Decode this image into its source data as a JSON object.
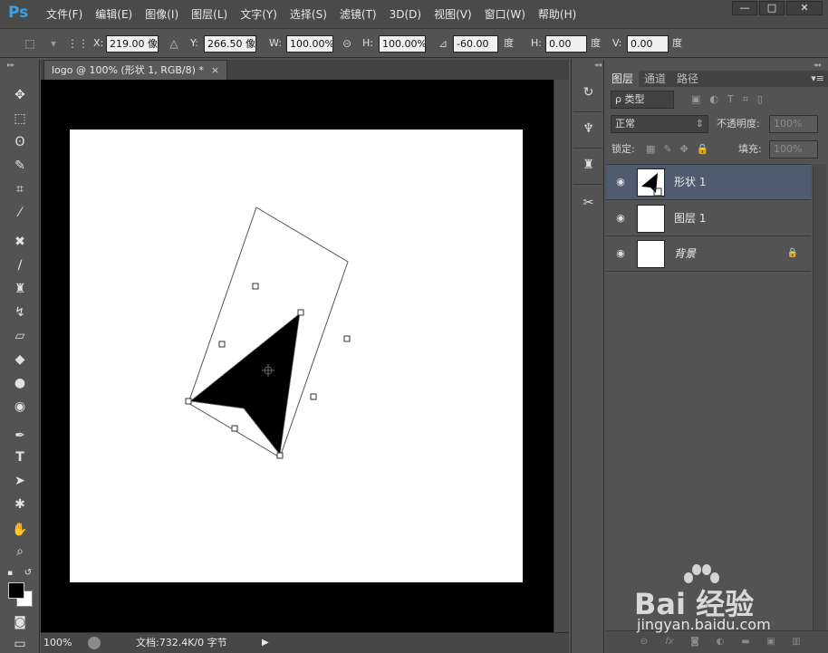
{
  "app": {
    "logo": "Ps"
  },
  "menu": [
    "文件(F)",
    "编辑(E)",
    "图像(I)",
    "图层(L)",
    "文字(Y)",
    "选择(S)",
    "滤镜(T)",
    "3D(D)",
    "视图(V)",
    "窗口(W)",
    "帮助(H)"
  ],
  "window_controls": {
    "minimize": "—",
    "maximize": "□",
    "close": "✕"
  },
  "options": {
    "x_label": "X:",
    "x_value": "219.00 像",
    "delta_icon": "△",
    "y_label": "Y:",
    "y_value": "266.50 像",
    "w_label": "W:",
    "w_value": "100.00%",
    "link_icon": "⊝",
    "h_label": "H:",
    "h_value": "100.00%",
    "angle_icon": "⊿",
    "angle_value": "-60.00",
    "angle_unit": "度",
    "hskew_label": "H:",
    "hskew_value": "0.00",
    "hskew_unit": "度",
    "vskew_label": "V:",
    "vskew_value": "0.00",
    "vskew_unit": "度"
  },
  "document": {
    "tab_title": "logo @ 100% (形状 1, RGB/8) *",
    "tab_close": "×"
  },
  "status": {
    "zoom": "100%",
    "doc_info": "文档:732.4K/0 字节",
    "arrow": "▶"
  },
  "layers_panel": {
    "collapse": "◂◂",
    "tabs": [
      "图层",
      "通道",
      "路径"
    ],
    "menu_icon": "▾≡",
    "filter_kind": "ρ 类型",
    "blend_mode": "正常",
    "opacity_label": "不透明度:",
    "opacity_value": "100%",
    "lock_label": "锁定:",
    "fill_label": "填充:",
    "fill_value": "100%",
    "layers": [
      {
        "name": "形状 1",
        "selected": true,
        "italic": false,
        "locked": false
      },
      {
        "name": "图层 1",
        "selected": false,
        "italic": false,
        "locked": false
      },
      {
        "name": "背景",
        "selected": false,
        "italic": true,
        "locked": true
      }
    ]
  },
  "watermark": {
    "brand": "Bai 经验",
    "url": "jingyan.baidu.com"
  },
  "colors": {
    "accent_blue": "#3aa0e8",
    "selected_layer": "#4f5b6e",
    "canvas_bg": "#000000",
    "paper": "#ffffff"
  }
}
